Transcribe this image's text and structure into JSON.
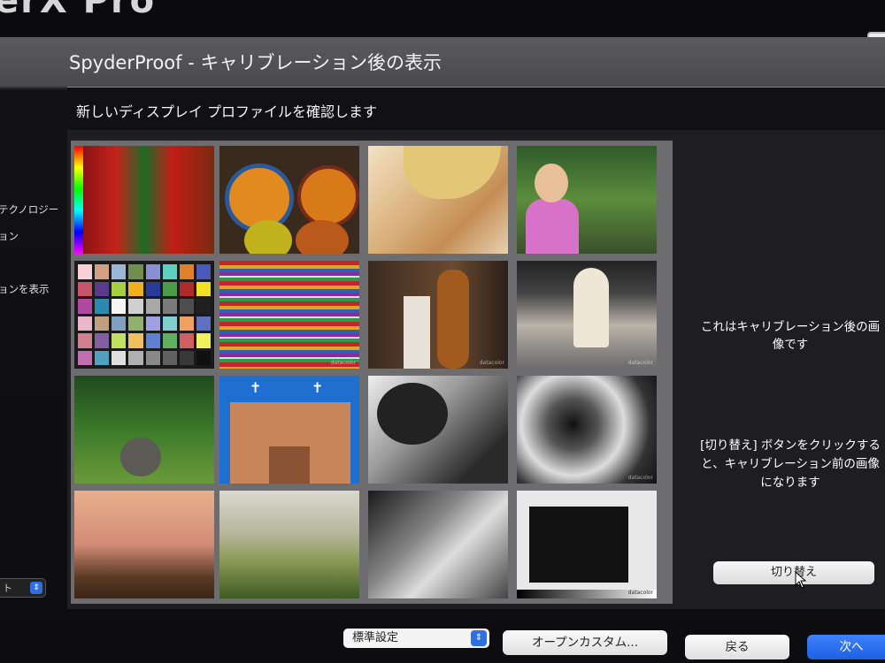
{
  "window": {
    "app_title": "erX Pro",
    "dialog_title": "SpyderProof - キャリブレーション後の表示"
  },
  "sidebar": {
    "items": [
      {
        "label": "テクノロジー"
      },
      {
        "label": "ョン"
      },
      {
        "label": "ョンを表示"
      }
    ],
    "select_value": "ト"
  },
  "panel": {
    "heading": "新しいディスプレイ プロファイルを確認します",
    "images": [
      {
        "name": "peppers-image",
        "watermark": ""
      },
      {
        "name": "plates-image",
        "watermark": ""
      },
      {
        "name": "woman-portrait-image",
        "watermark": ""
      },
      {
        "name": "girl-flowers-image",
        "watermark": ""
      },
      {
        "name": "color-checker-image",
        "watermark": ""
      },
      {
        "name": "fabric-rolls-image",
        "watermark": "datacolor"
      },
      {
        "name": "bass-player-image",
        "watermark": "datacolor"
      },
      {
        "name": "marilyn-street-image",
        "watermark": "datacolor"
      },
      {
        "name": "garden-urn-image",
        "watermark": ""
      },
      {
        "name": "adobe-church-image",
        "watermark": ""
      },
      {
        "name": "bw-portrait-image",
        "watermark": ""
      },
      {
        "name": "spiral-stair-image",
        "watermark": "datacolor"
      },
      {
        "name": "sunset-hills-image",
        "watermark": ""
      },
      {
        "name": "tuscany-image",
        "watermark": ""
      },
      {
        "name": "scooter-image",
        "watermark": ""
      },
      {
        "name": "bw-test-image",
        "watermark": "datacolor"
      }
    ],
    "info_after": "これはキャリブレーション後の画像です",
    "info_toggle": "[切り替え] ボタンをクリックすると、キャリブレーション前の画像になります",
    "toggle_label": "切り替え"
  },
  "bottom": {
    "select_value": "標準設定",
    "custom_label": "オープンカスタム...",
    "back_label": "戻る",
    "next_label": "次へ"
  }
}
